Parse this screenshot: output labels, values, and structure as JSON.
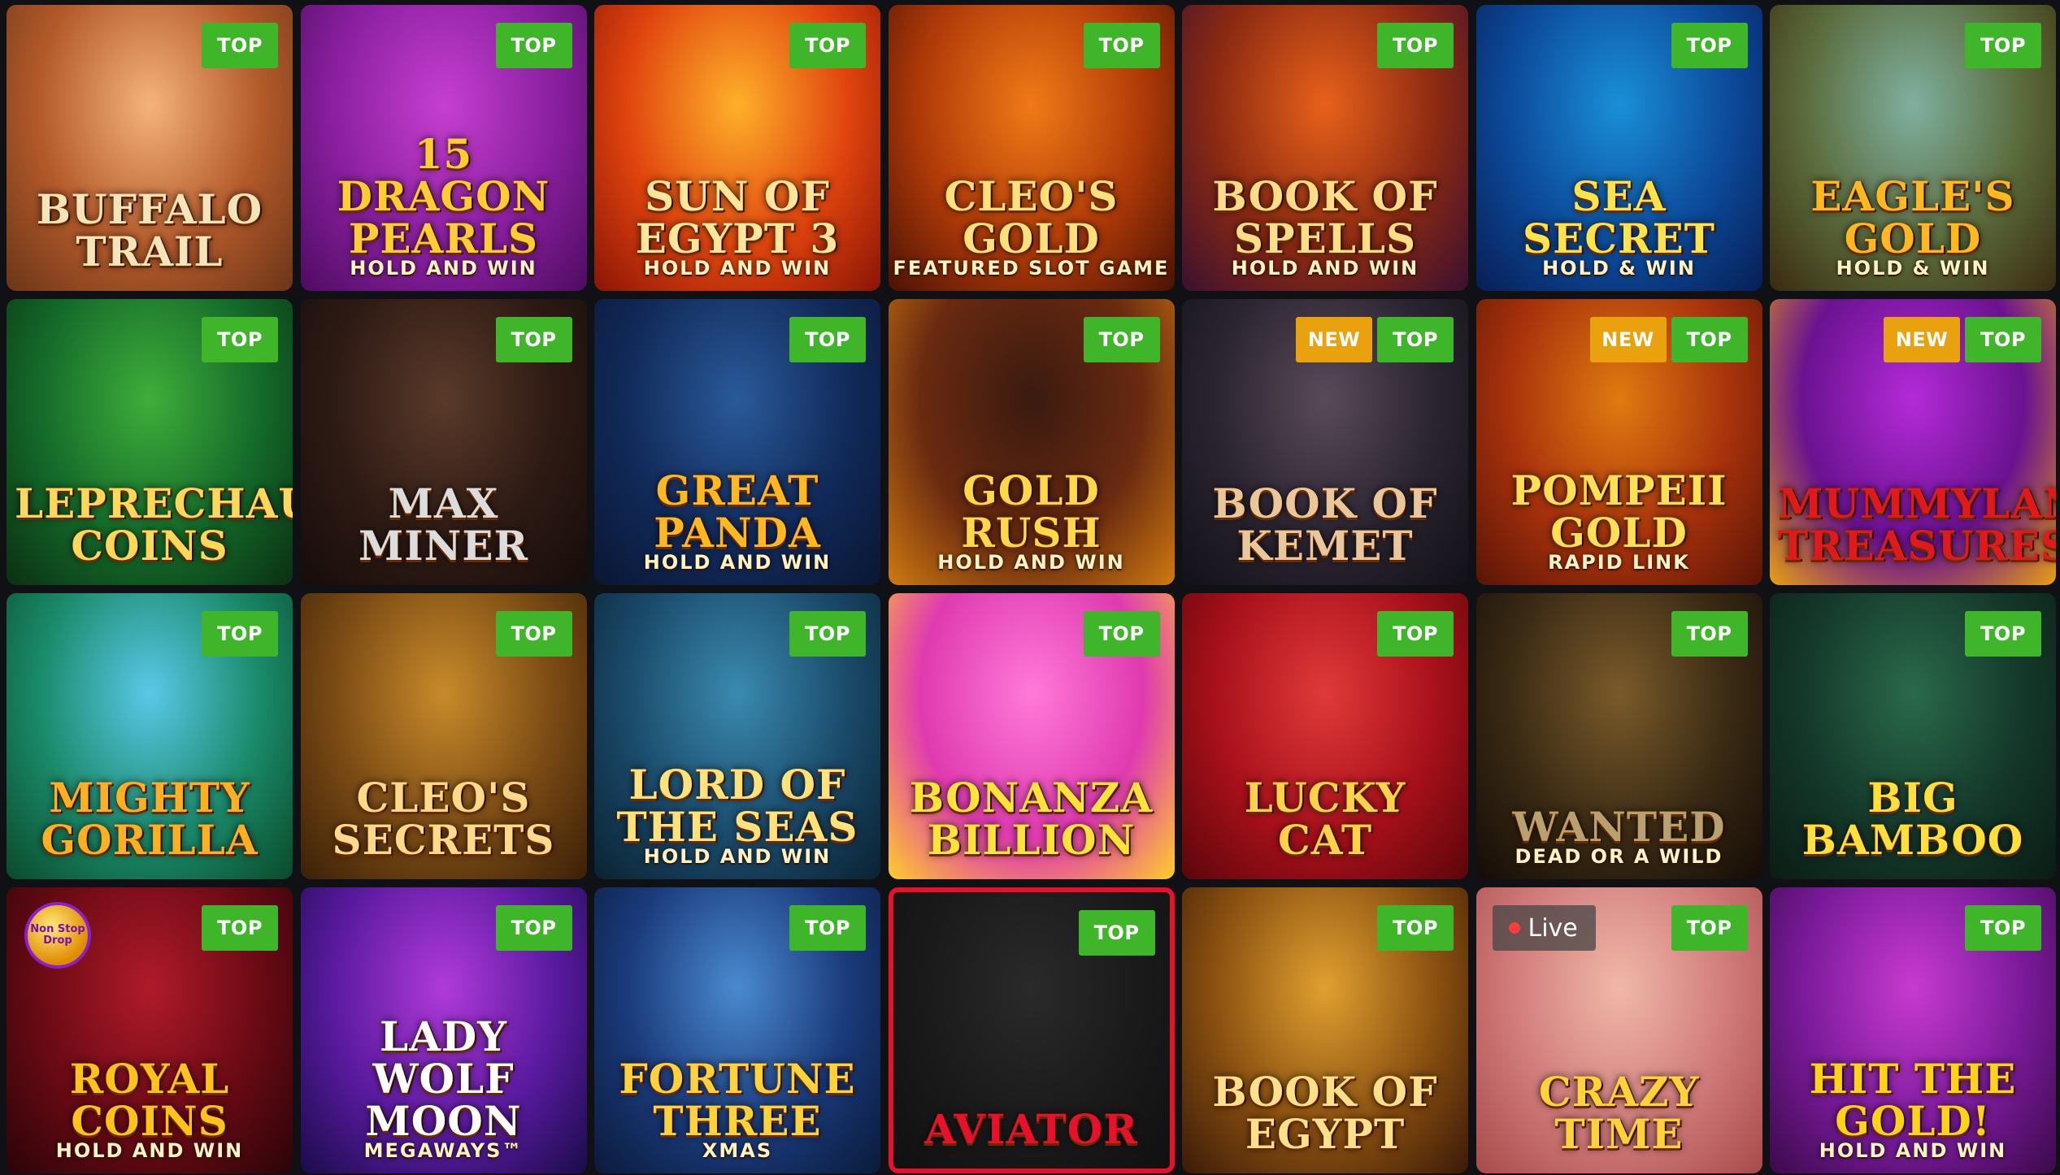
{
  "games": [
    {
      "name": "buffalo-trail",
      "title": "Buffalo Trail",
      "subtitle": "",
      "badges": [
        "TOP"
      ],
      "bg": [
        "#f4b37a",
        "#b45a2a",
        "#6a3518"
      ],
      "title_color": "#f5e4b8"
    },
    {
      "name": "15-dragon-pearls",
      "title": "15 Dragon Pearls",
      "subtitle": "Hold and Win",
      "badges": [
        "TOP"
      ],
      "bg": [
        "#c63fd0",
        "#8a1fa0",
        "#4d0c60"
      ],
      "title_color": "#ffcc33"
    },
    {
      "name": "sun-of-egypt-3",
      "title": "Sun of Egypt 3",
      "subtitle": "Hold and Win",
      "badges": [
        "TOP"
      ],
      "bg": [
        "#ffb02a",
        "#e0440e",
        "#8a1406"
      ],
      "title_color": "#ffe69a"
    },
    {
      "name": "cleos-gold",
      "title": "Cleo's Gold",
      "subtitle": "Featured Slot Game",
      "badges": [
        "TOP"
      ],
      "bg": [
        "#f07a16",
        "#b03a08",
        "#4a1204"
      ],
      "title_color": "#ffe07a"
    },
    {
      "name": "book-of-spells",
      "title": "Book of Spells",
      "subtitle": "Hold and Win",
      "badges": [
        "TOP"
      ],
      "bg": [
        "#e8611a",
        "#8c2a12",
        "#3a1030"
      ],
      "title_color": "#ffdc88"
    },
    {
      "name": "sea-secret",
      "title": "Sea Secret",
      "subtitle": "Hold & Win",
      "badges": [
        "TOP"
      ],
      "bg": [
        "#1a8fd8",
        "#0c4a9a",
        "#071e55"
      ],
      "title_color": "#ffe34a"
    },
    {
      "name": "eagles-gold",
      "title": "Eagle's Gold",
      "subtitle": "Hold & Win",
      "badges": [
        "TOP"
      ],
      "bg": [
        "#7fb0a0",
        "#5a6a3a",
        "#3a2a10"
      ],
      "title_color": "#ffb820"
    },
    {
      "name": "leprechauns-coins",
      "title": "Leprechaun's Coins",
      "subtitle": "",
      "badges": [
        "TOP"
      ],
      "bg": [
        "#3fae3a",
        "#146a2a",
        "#0a3012"
      ],
      "title_color": "#ffd75a"
    },
    {
      "name": "max-miner",
      "title": "Max Miner",
      "subtitle": "",
      "badges": [
        "TOP"
      ],
      "bg": [
        "#5a3a2a",
        "#2e1a14",
        "#160c0a"
      ],
      "title_color": "#dcdcdc"
    },
    {
      "name": "great-panda",
      "title": "Great Panda",
      "subtitle": "Hold and Win",
      "badges": [
        "TOP"
      ],
      "bg": [
        "#2a5a9a",
        "#112a5a",
        "#0a1632"
      ],
      "title_color": "#ffb820"
    },
    {
      "name": "gold-rush-johnny-cash",
      "title": "Gold Rush",
      "subtitle": "Hold and Win",
      "badges": [
        "TOP"
      ],
      "bg": [
        "#3a1a10",
        "#6a2a10",
        "#d07a10"
      ],
      "title_color": "#ffd84a"
    },
    {
      "name": "book-of-kemet",
      "title": "Book of Kemet",
      "subtitle": "",
      "badges": [
        "NEW",
        "TOP"
      ],
      "bg": [
        "#5a4a58",
        "#2a2430",
        "#121018"
      ],
      "title_color": "#e9c79a"
    },
    {
      "name": "pompeii-gold",
      "title": "Pompeii Gold",
      "subtitle": "Rapid Link",
      "badges": [
        "NEW",
        "TOP"
      ],
      "bg": [
        "#e07a10",
        "#a8320c",
        "#5a1406"
      ],
      "title_color": "#ffe055"
    },
    {
      "name": "mummyland-treasures",
      "title": "Mummyland Treasures",
      "subtitle": "",
      "badges": [
        "NEW",
        "TOP"
      ],
      "bg": [
        "#b42ad8",
        "#6a1290",
        "#e8a010"
      ],
      "title_color": "#e01a1a"
    },
    {
      "name": "mighty-gorilla",
      "title": "Mighty Gorilla",
      "subtitle": "",
      "badges": [
        "TOP"
      ],
      "bg": [
        "#5ac8e8",
        "#1a8a6a",
        "#0a4a2a"
      ],
      "title_color": "#ffb020"
    },
    {
      "name": "cleos-secrets",
      "title": "Cleo's Secrets",
      "subtitle": "",
      "badges": [
        "TOP"
      ],
      "bg": [
        "#c88a2a",
        "#7a4a14",
        "#3a2008"
      ],
      "title_color": "#ffd98a"
    },
    {
      "name": "lord-of-the-seas",
      "title": "Lord of the Seas",
      "subtitle": "Hold and Win",
      "badges": [
        "TOP"
      ],
      "bg": [
        "#3a8ab0",
        "#1a4a6a",
        "#0a2232"
      ],
      "title_color": "#ffe27a"
    },
    {
      "name": "bonanza-billion",
      "title": "Bonanza Billion",
      "subtitle": "",
      "badges": [
        "TOP"
      ],
      "bg": [
        "#ff7ad8",
        "#e03ab0",
        "#ffce2a"
      ],
      "title_color": "#ffe23a"
    },
    {
      "name": "lucky-cat",
      "title": "Lucky Cat",
      "subtitle": "",
      "badges": [
        "TOP"
      ],
      "bg": [
        "#e03a3a",
        "#a8101a",
        "#5a060a"
      ],
      "title_color": "#ffd24a"
    },
    {
      "name": "wanted-dead-or-a-wild",
      "title": "Wanted",
      "subtitle": "Dead or a Wild",
      "badges": [
        "TOP"
      ],
      "bg": [
        "#7a5a2a",
        "#3a2a14",
        "#140c06"
      ],
      "title_color": "#b8a070"
    },
    {
      "name": "big-bamboo",
      "title": "Big Bamboo",
      "subtitle": "",
      "badges": [
        "TOP"
      ],
      "bg": [
        "#2a6a4a",
        "#14382a",
        "#0a1c14"
      ],
      "title_color": "#ffe03a"
    },
    {
      "name": "royal-coins",
      "title": "Royal Coins",
      "subtitle": "Hold and Win",
      "badges": [
        "TOP"
      ],
      "bg": [
        "#b01a2a",
        "#6a0a14",
        "#2a0408"
      ],
      "title_color": "#ffc21a",
      "extra": "Non Stop Drop"
    },
    {
      "name": "lady-wolf-moon-megaways",
      "title": "Lady Wolf Moon",
      "subtitle": "Megaways™",
      "badges": [
        "TOP"
      ],
      "bg": [
        "#b03ad8",
        "#5a1aa0",
        "#1a0c4a"
      ],
      "title_color": "#ffffff"
    },
    {
      "name": "fortune-three-xmas",
      "title": "Fortune Three",
      "subtitle": "Xmas",
      "badges": [
        "TOP"
      ],
      "bg": [
        "#4a8ad0",
        "#1a3a7a",
        "#0a1a3a"
      ],
      "title_color": "#ffd23a"
    },
    {
      "name": "aviator",
      "title": "Aviator",
      "subtitle": "",
      "badges": [
        "TOP"
      ],
      "bg": [
        "#2a2a2a",
        "#1a1a1a",
        "#101010"
      ],
      "title_color": "#e8102a"
    },
    {
      "name": "book-of-egypt",
      "title": "Book of Egypt",
      "subtitle": "",
      "badges": [
        "TOP"
      ],
      "bg": [
        "#e0a030",
        "#8a5010",
        "#3a1a08"
      ],
      "title_color": "#ffe08a"
    },
    {
      "name": "crazy-time",
      "title": "Crazy Time",
      "subtitle": "",
      "badges": [
        "TOP"
      ],
      "bg": [
        "#f0b8a8",
        "#d07a7a",
        "#a84a4a"
      ],
      "title_color": "#ffd23a",
      "live": "Live"
    },
    {
      "name": "hit-the-gold",
      "title": "Hit the Gold!",
      "subtitle": "Hold and Win",
      "badges": [
        "TOP"
      ],
      "bg": [
        "#c83ad0",
        "#7a1a9a",
        "#3a0a4a"
      ],
      "title_color": "#ffd21a"
    }
  ]
}
